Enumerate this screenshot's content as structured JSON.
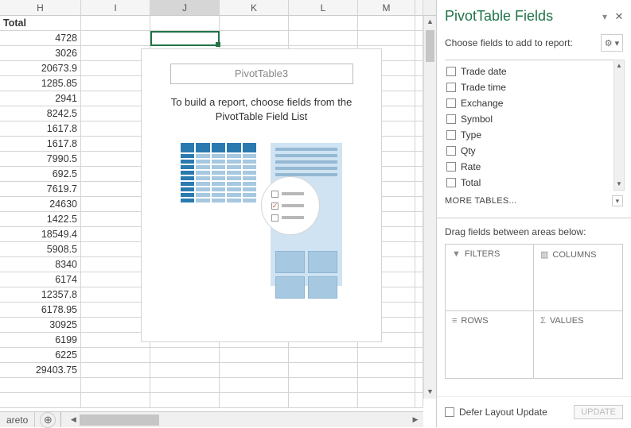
{
  "columns": {
    "h": "H",
    "i": "I",
    "j": "J",
    "k": "K",
    "l": "L",
    "m": "M"
  },
  "col_h_header": "Total",
  "col_h_values": [
    "4728",
    "3026",
    "20673.9",
    "1285.85",
    "2941",
    "8242.5",
    "1617.8",
    "1617.8",
    "7990.5",
    "692.5",
    "7619.7",
    "24630",
    "1422.5",
    "18549.4",
    "5908.5",
    "8340",
    "6174",
    "12357.8",
    "6178.95",
    "30925",
    "6199",
    "6225",
    "29403.75"
  ],
  "pivot": {
    "name": "PivotTable3",
    "hint_l1": "To build a report, choose fields from the",
    "hint_l2": "PivotTable Field List"
  },
  "taskpane": {
    "title": "PivotTable Fields",
    "subtitle": "Choose fields to add to report:",
    "more": "MORE TABLES...",
    "drag_hint": "Drag fields between areas below:",
    "fields": {
      "f0": "Trade date",
      "f1": "Trade time",
      "f2": "Exchange",
      "f3": "Symbol",
      "f4": "Type",
      "f5": "Qty",
      "f6": "Rate",
      "f7": "Total"
    },
    "areas": {
      "filters": "FILTERS",
      "columns": "COLUMNS",
      "rows": "ROWS",
      "values": "VALUES"
    },
    "defer": "Defer Layout Update",
    "update": "UPDATE"
  },
  "sheet_tab": "areto"
}
